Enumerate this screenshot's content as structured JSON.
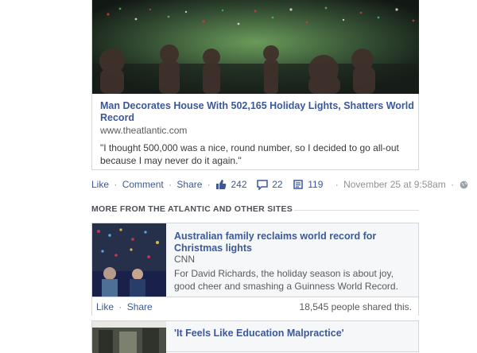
{
  "main_story": {
    "title": "Man Decorates House With 502,165 Holiday Lights, Shatters World Record",
    "domain": "www.theatlantic.com",
    "quote": "\"I thought 500,000 was a nice, round number, so I decided to go all-out because I may never do it again.\""
  },
  "actions": {
    "like": "Like",
    "comment": "Comment",
    "share": "Share",
    "likes_count": "242",
    "comments_count": "22",
    "shares_count": "119",
    "timestamp": "November 25 at 9:58am",
    "separator": "·"
  },
  "section": {
    "header": "MORE FROM THE ATLANTIC AND OTHER SITES"
  },
  "related": [
    {
      "title": "Australian family reclaims world record for Christmas lights",
      "source": "CNN",
      "text": "For David Richards, the holiday season is about joy, good cheer and smashing a Guinness World Record.",
      "like": "Like",
      "share": "Share",
      "shares_text": "18,545 people shared this."
    },
    {
      "title": "'It Feels Like Education Malpractice'"
    }
  ],
  "icons": {
    "like": "thumbs-up-icon",
    "comment": "comment-icon",
    "share": "share-icon",
    "privacy": "globe-icon"
  },
  "colors": {
    "link": "#3b5998",
    "muted": "#8f9396",
    "border": "#d3d6db"
  }
}
